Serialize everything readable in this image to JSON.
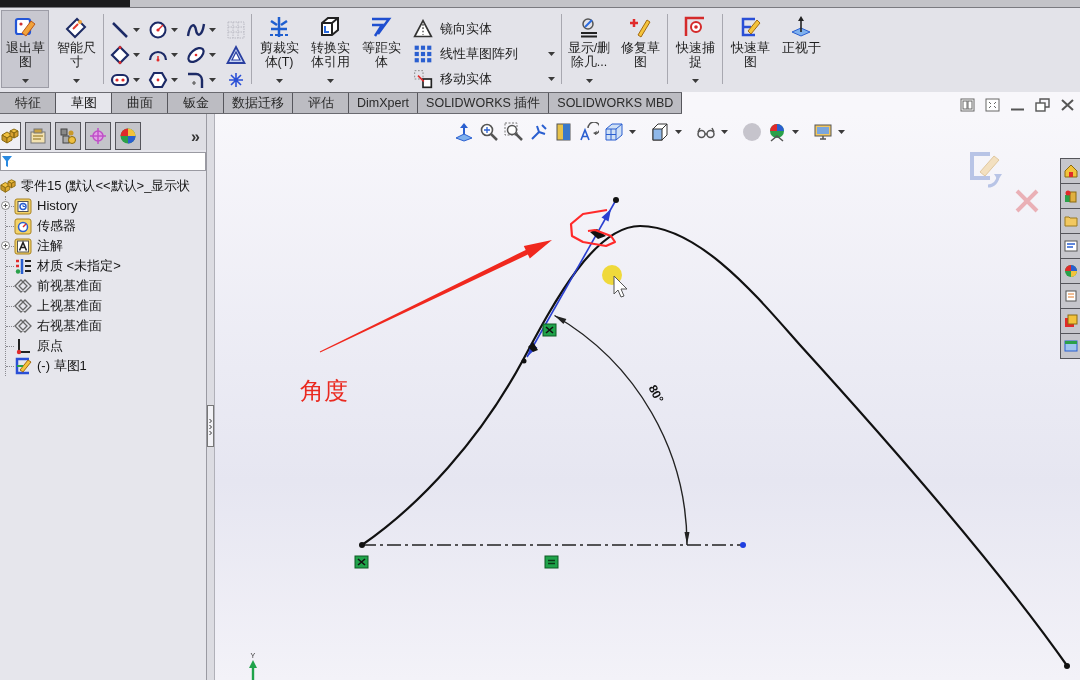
{
  "ribbon": {
    "groups": [
      {
        "kind": "buttons",
        "items": [
          {
            "kind": "large",
            "label": "退出草图",
            "selected": true,
            "dropdown": true
          },
          {
            "kind": "large",
            "label": "智能尺寸",
            "selected": false,
            "dropdown": true
          }
        ]
      },
      {
        "kind": "tool_grid"
      },
      {
        "kind": "buttons",
        "items": [
          {
            "kind": "large",
            "label": "剪裁实体(T)",
            "selected": false,
            "dropdown": true
          },
          {
            "kind": "large",
            "label": "转换实体引用",
            "selected": false,
            "dropdown": true
          },
          {
            "kind": "large",
            "label": "等距实体",
            "selected": false,
            "dropdown": false
          },
          {
            "kind": "small",
            "label": "镜向实体",
            "selected": false,
            "dropdown": false
          },
          {
            "kind": "small",
            "label": "线性草图阵列",
            "selected": false,
            "dropdown": true
          },
          {
            "kind": "small",
            "label": "移动实体",
            "selected": false,
            "dropdown": true
          }
        ]
      },
      {
        "kind": "buttons",
        "items": [
          {
            "kind": "large",
            "label": "显示/删除几...",
            "selected": false,
            "dropdown": true
          },
          {
            "kind": "large",
            "label": "修复草图",
            "selected": false,
            "dropdown": false
          }
        ]
      },
      {
        "kind": "buttons",
        "items": [
          {
            "kind": "large",
            "label": "快速捕捉",
            "selected": false,
            "dropdown": true
          }
        ]
      },
      {
        "kind": "buttons",
        "items": [
          {
            "kind": "large",
            "label": "快速草图",
            "selected": false,
            "dropdown": false
          },
          {
            "kind": "large",
            "label": "正视于",
            "selected": false,
            "dropdown": false
          }
        ]
      }
    ]
  },
  "tabs": [
    {
      "label": "特征",
      "selected": false
    },
    {
      "label": "草图",
      "selected": true
    },
    {
      "label": "曲面",
      "selected": false
    },
    {
      "label": "钣金",
      "selected": false
    },
    {
      "label": "数据迁移",
      "selected": false
    },
    {
      "label": "评估",
      "selected": false
    },
    {
      "label": "DimXpert",
      "selected": false
    },
    {
      "label": "SOLIDWORKS 插件",
      "selected": false
    },
    {
      "label": "SOLIDWORKS MBD",
      "selected": false
    }
  ],
  "feature_manager": {
    "panel_tabs": [
      {
        "selected": true
      },
      {
        "selected": false
      },
      {
        "selected": false
      },
      {
        "selected": false
      },
      {
        "selected": false
      }
    ],
    "more": "»",
    "tree": {
      "kind": "part",
      "label": "零件15 (默认<<默认>_显示状",
      "children": [
        {
          "kind": "history",
          "label": "History",
          "expandable": true
        },
        {
          "kind": "sensors",
          "label": "传感器",
          "expandable": false
        },
        {
          "kind": "annotations",
          "label": "注解",
          "expandable": true
        },
        {
          "kind": "material",
          "label": "材质 <未指定>",
          "expandable": false
        },
        {
          "kind": "plane",
          "label": "前视基准面",
          "expandable": false
        },
        {
          "kind": "plane",
          "label": "上视基准面",
          "expandable": false
        },
        {
          "kind": "plane",
          "label": "右视基准面",
          "expandable": false
        },
        {
          "kind": "origin",
          "label": "原点",
          "expandable": false
        },
        {
          "kind": "sketch",
          "label": "(-) 草图1",
          "expandable": false
        }
      ]
    }
  },
  "graphics_area": {
    "dimension": "80°",
    "annotation_label": "角度",
    "triad_label": "Y"
  }
}
